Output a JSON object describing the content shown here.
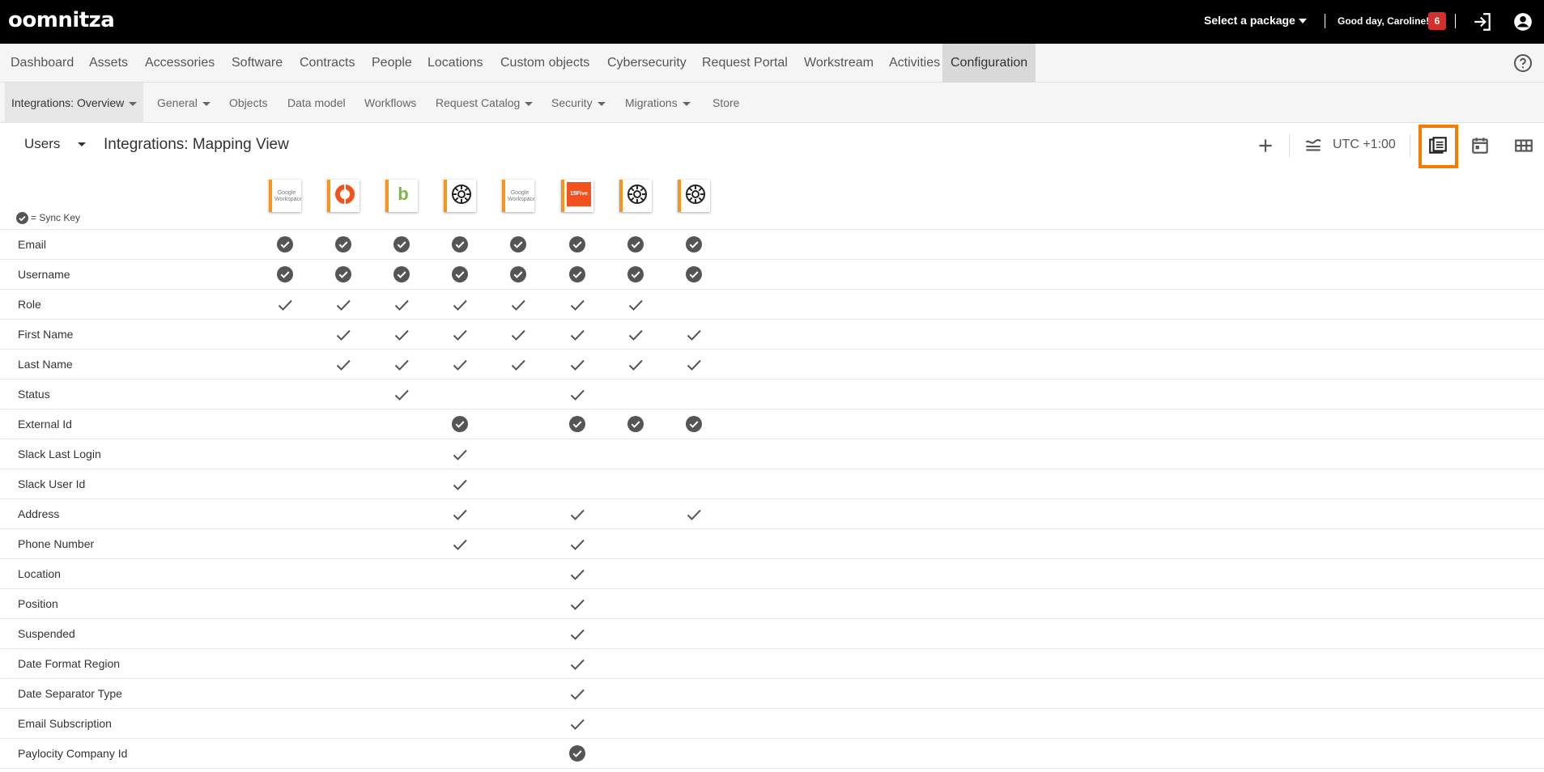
{
  "app": {
    "logo": "oomnitza",
    "package_selector": "Select a package",
    "greeting": "Good day, Caroline!",
    "notification_count": "6"
  },
  "main_nav": [
    {
      "label": "Dashboard"
    },
    {
      "label": "Assets"
    },
    {
      "label": "Accessories"
    },
    {
      "label": "Software"
    },
    {
      "label": "Contracts"
    },
    {
      "label": "People"
    },
    {
      "label": "Locations"
    },
    {
      "label": "Custom objects"
    },
    {
      "label": "Cybersecurity"
    },
    {
      "label": "Request Portal"
    },
    {
      "label": "Workstream"
    },
    {
      "label": "Activities"
    },
    {
      "label": "Configuration",
      "active": true
    }
  ],
  "sub_nav": [
    {
      "label": "Integrations: Overview",
      "dropdown": true,
      "active": true
    },
    {
      "label": "General",
      "dropdown": true
    },
    {
      "label": "Objects"
    },
    {
      "label": "Data model"
    },
    {
      "label": "Workflows"
    },
    {
      "label": "Request Catalog",
      "dropdown": true
    },
    {
      "label": "Security",
      "dropdown": true
    },
    {
      "label": "Migrations",
      "dropdown": true
    },
    {
      "label": "Store"
    }
  ],
  "header": {
    "object_selector": "Users",
    "title": "Integrations: Mapping View",
    "timezone": "UTC +1:00"
  },
  "legend": {
    "sync_key_label": "= Sync Key"
  },
  "integrations": [
    {
      "name": "google-workspace",
      "text": "Google Workspace"
    },
    {
      "name": "okta-like",
      "text": ""
    },
    {
      "name": "bamboohr",
      "text": "b"
    },
    {
      "name": "generic-connector",
      "text": ""
    },
    {
      "name": "google-workspace",
      "text": "Google Workspace"
    },
    {
      "name": "15five",
      "text": "15Five"
    },
    {
      "name": "generic-connector",
      "text": ""
    },
    {
      "name": "generic-connector",
      "text": ""
    }
  ],
  "fields": [
    {
      "label": "Email",
      "cells": [
        "key",
        "key",
        "key",
        "key",
        "key",
        "key",
        "key",
        "key"
      ]
    },
    {
      "label": "Username",
      "cells": [
        "key",
        "key",
        "key",
        "key",
        "key",
        "key",
        "key",
        "key"
      ]
    },
    {
      "label": "Role",
      "cells": [
        "check",
        "check",
        "check",
        "check",
        "check",
        "check",
        "check",
        ""
      ]
    },
    {
      "label": "First Name",
      "cells": [
        "",
        "check",
        "check",
        "check",
        "check",
        "check",
        "check",
        "check"
      ]
    },
    {
      "label": "Last Name",
      "cells": [
        "",
        "check",
        "check",
        "check",
        "check",
        "check",
        "check",
        "check"
      ]
    },
    {
      "label": "Status",
      "cells": [
        "",
        "",
        "check",
        "",
        "",
        "check",
        "",
        ""
      ]
    },
    {
      "label": "External Id",
      "cells": [
        "",
        "",
        "",
        "key",
        "",
        "key",
        "key",
        "key"
      ]
    },
    {
      "label": "Slack Last Login",
      "cells": [
        "",
        "",
        "",
        "check",
        "",
        "",
        "",
        ""
      ]
    },
    {
      "label": "Slack User Id",
      "cells": [
        "",
        "",
        "",
        "check",
        "",
        "",
        "",
        ""
      ]
    },
    {
      "label": "Address",
      "cells": [
        "",
        "",
        "",
        "check",
        "",
        "check",
        "",
        "check"
      ]
    },
    {
      "label": "Phone Number",
      "cells": [
        "",
        "",
        "",
        "check",
        "",
        "check",
        "",
        ""
      ]
    },
    {
      "label": "Location",
      "cells": [
        "",
        "",
        "",
        "",
        "",
        "check",
        "",
        ""
      ]
    },
    {
      "label": "Position",
      "cells": [
        "",
        "",
        "",
        "",
        "",
        "check",
        "",
        ""
      ]
    },
    {
      "label": "Suspended",
      "cells": [
        "",
        "",
        "",
        "",
        "",
        "check",
        "",
        ""
      ]
    },
    {
      "label": "Date Format Region",
      "cells": [
        "",
        "",
        "",
        "",
        "",
        "check",
        "",
        ""
      ]
    },
    {
      "label": "Date Separator Type",
      "cells": [
        "",
        "",
        "",
        "",
        "",
        "check",
        "",
        ""
      ]
    },
    {
      "label": "Email Subscription",
      "cells": [
        "",
        "",
        "",
        "",
        "",
        "check",
        "",
        ""
      ]
    },
    {
      "label": "Paylocity Company Id",
      "cells": [
        "",
        "",
        "",
        "",
        "",
        "key",
        "",
        ""
      ]
    }
  ],
  "colors": {
    "accent": "#f57c00",
    "topbar": "#000000",
    "badge": "#d32f2f",
    "check": "#555555"
  }
}
